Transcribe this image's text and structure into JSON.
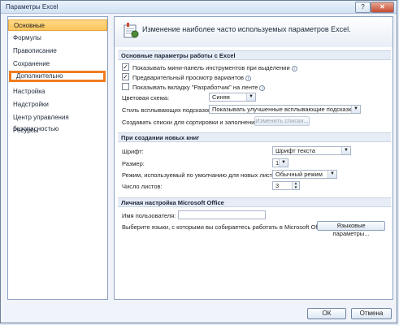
{
  "window": {
    "title": "Параметры Excel",
    "help": "?",
    "close": "✕"
  },
  "sidebar": {
    "items": [
      {
        "label": "Основные"
      },
      {
        "label": "Формулы"
      },
      {
        "label": "Правописание"
      },
      {
        "label": "Сохранение"
      },
      {
        "label": "Дополнительно"
      },
      {
        "label": "Настройка"
      },
      {
        "label": "Надстройки"
      },
      {
        "label": "Центр управления безопасностью"
      },
      {
        "label": "Ресурсы"
      }
    ]
  },
  "header": {
    "text": "Изменение наиболее часто используемых параметров Excel."
  },
  "sections": {
    "main": "Основные параметры работы с Excel",
    "new_book": "При создании новых книг",
    "personal": "Личная настройка Microsoft Office"
  },
  "main": {
    "cb1": {
      "checked": "✓",
      "label": "Показывать мини-панель инструментов при выделении"
    },
    "cb2": {
      "checked": "✓",
      "label": "Предварительный просмотр вариантов"
    },
    "cb3": {
      "checked": "",
      "label": "Показывать вкладку \"Разработчик\" на ленте"
    },
    "scheme_label": "Цветовая схема:",
    "scheme_value": "Синяя",
    "tooltip_label": "Стиль всплывающих подсказок:",
    "tooltip_value": "Показывать улучшенные всплывающие подсказки",
    "lists_label": "Создавать списки для сортировки и заполнения:",
    "lists_button": "Изменить списки..."
  },
  "new_book": {
    "font_label": "Шрифт:",
    "font_value": "Шрифт текста",
    "size_label": "Размер:",
    "size_value": "11",
    "view_label": "Режим, используемый по умолчанию для новых листов:",
    "view_value": "Обычный режим",
    "sheets_label": "Число листов:",
    "sheets_value": "3"
  },
  "personal": {
    "user_label": "Имя пользователя:",
    "user_value": "",
    "lang_label": "Выберите языки, с которыми вы собираетесь работать в Microsoft Office:",
    "lang_button": "Языковые параметры..."
  },
  "footer": {
    "ok": "ОК",
    "cancel": "Отмена"
  }
}
